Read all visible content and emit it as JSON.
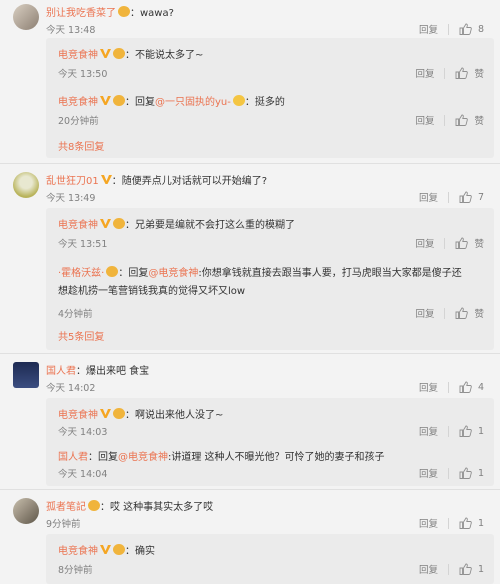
{
  "comments": [
    {
      "user": "别让我吃香菜了",
      "text": "：wawa?",
      "time": "今天 13:48",
      "reply_label": "回复",
      "likes": "8",
      "replies": [
        {
          "user": "电竞食神",
          "text": "：不能说太多了~",
          "time": "今天 13:50",
          "reply_label": "回复",
          "likes": "",
          "like_label": "赞"
        },
        {
          "user": "电竞食神",
          "prefix": "：回复",
          "mention": "@一只固执的yu-",
          "text": "：挺多的",
          "time": "20分钟前",
          "reply_label": "回复",
          "like_label": "赞"
        }
      ],
      "more": "共8条回复"
    },
    {
      "user": "乱世狂刀01",
      "text": "：随便弄点儿对话就可以开始编了?",
      "time": "今天 13:49",
      "reply_label": "回复",
      "likes": "7",
      "replies": [
        {
          "user": "电竞食神",
          "text": "：兄弟要是编就不会打这么重的模糊了",
          "time": "今天 13:51",
          "reply_label": "回复",
          "like_label": "赞"
        },
        {
          "user": "·霍格沃兹·",
          "prefix": "：回复",
          "mention": "@电竞食神",
          "text": ":你想拿钱就直接去跟当事人要，打马虎眼当大家都是傻子还",
          "text2": "想趁机捞一笔营销钱我真的觉得又坏又low",
          "time": "4分钟前",
          "reply_label": "回复",
          "like_label": "赞"
        }
      ],
      "more": "共5条回复"
    },
    {
      "user": "国人君",
      "text": "：爆出来吧 食宝",
      "time": "今天 14:02",
      "reply_label": "回复",
      "likes": "4",
      "replies": [
        {
          "user": "电竞食神",
          "text": "：啊说出来他人没了~",
          "time": "今天 14:03",
          "reply_label": "回复",
          "likes": "1"
        },
        {
          "user": "国人君",
          "prefix": "：回复",
          "mention": "@电竞食神",
          "text": ":讲道理 这种人不曝光他？可怜了她的妻子和孩子",
          "time": "今天 14:04",
          "reply_label": "回复",
          "likes": "1"
        }
      ]
    },
    {
      "user": "孤者笔記",
      "text": "：哎 这种事其实太多了哎",
      "time": "9分钟前",
      "reply_label": "回复",
      "likes": "1",
      "replies": [
        {
          "user": "电竞食神",
          "text": "：确实",
          "time": "8分钟前",
          "reply_label": "回复",
          "likes": "1"
        }
      ]
    }
  ],
  "colors": {
    "name": "#eb7350",
    "meta": "#808080",
    "bg": "#f3f3f3",
    "reply_bg": "#ebebeb"
  }
}
